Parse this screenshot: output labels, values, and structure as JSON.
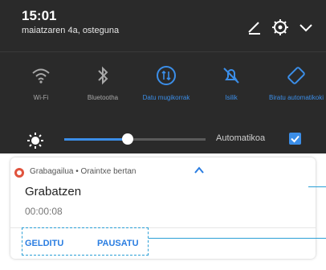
{
  "status": {
    "time": "15:01",
    "date": "maiatzaren 4a, osteguna"
  },
  "header_icons": [
    "edit-icon",
    "gear-icon",
    "chevron-down-icon"
  ],
  "tiles": [
    {
      "label": "Wi-Fi",
      "icon": "wifi-icon",
      "on": false
    },
    {
      "label": "Bluetootha",
      "icon": "bluetooth-icon",
      "on": false
    },
    {
      "label": "Datu mugikorrak",
      "icon": "mobile-data-icon",
      "on": true
    },
    {
      "label": "Isilik",
      "icon": "silent-icon",
      "on": true
    },
    {
      "label": "Biratu automatikoki",
      "icon": "auto-rotate-icon",
      "on": true
    }
  ],
  "brightness": {
    "level": 0.45,
    "auto_label": "Automatikoa",
    "auto_checked": true
  },
  "notification": {
    "app": "Grabagailua",
    "separator": "•",
    "when": "Oraintxe bertan",
    "app_line": "Grabagailua • Oraintxe bertan",
    "title": "Grabatzen",
    "timer": "00:00:08",
    "actions": [
      "GELDITU",
      "PAUSATU"
    ]
  },
  "colors": {
    "shade": "#2a2a2a",
    "accent": "#3b8ee8",
    "annotation": "#2a9fd6",
    "record": "#e0533d"
  }
}
